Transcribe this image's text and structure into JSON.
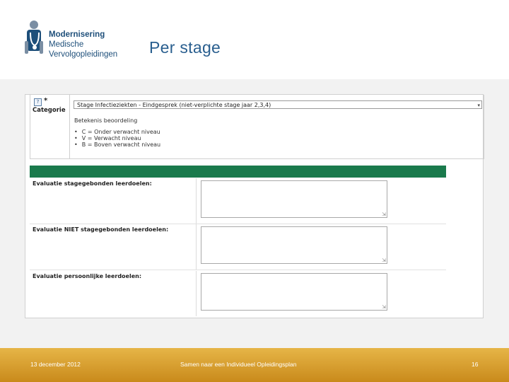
{
  "logo": {
    "line1": "Modernisering",
    "line2": "Medische",
    "line3": "Vervolgopleidingen"
  },
  "slide_title": "Per stage",
  "form": {
    "help_icon": "?",
    "required_mark": "*",
    "category_label": "Categorie",
    "selected_stage": "Stage Infectieziekten - Eindgesprek (niet-verplichte stage jaar 2,3,4)",
    "meaning_title": "Betekenis beoordeling",
    "meanings": [
      "C = Onder verwacht niveau",
      "V = Verwacht niveau",
      "B = Boven verwacht niveau"
    ],
    "evaluations": [
      {
        "label": "Evaluatie stagegebonden leerdoelen:",
        "value": ""
      },
      {
        "label": "Evaluatie NIET stagegebonden leerdoelen:",
        "value": ""
      },
      {
        "label": "Evaluatie persoonlijke leerdoelen:",
        "value": ""
      }
    ],
    "header_bar_color": "#1a7a4c"
  },
  "footer": {
    "date": "13 december 2012",
    "subtitle": "Samen naar een Individueel Opleidingsplan",
    "page": "16",
    "color": "#d9a230"
  },
  "icons": {
    "logo": "doctor-stethoscope-icon",
    "help": "help-icon",
    "dropdown": "chevron-down-icon",
    "resize": "resize-grip-icon"
  }
}
